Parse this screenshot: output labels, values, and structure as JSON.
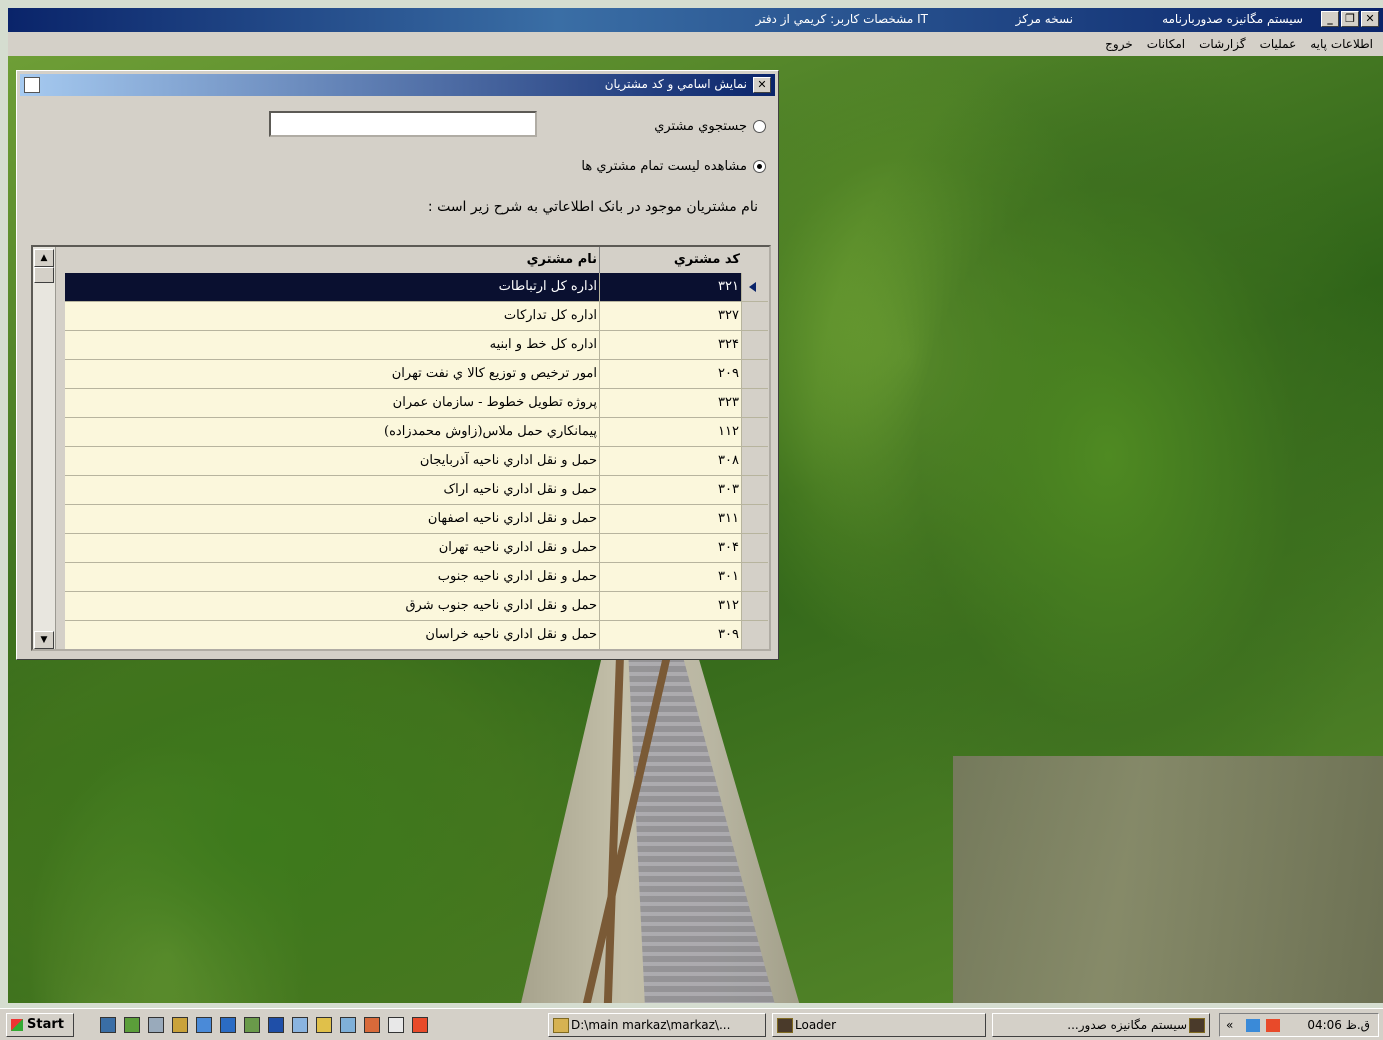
{
  "app": {
    "title_main": "سيستم مگانيزه صدوربارنامه",
    "title_version": "نسخه مرکز",
    "title_user": "مشخصات کاربر: کريمي از دفتر IT"
  },
  "menu": [
    "اطلاعات پايه",
    "عمليات",
    "گزارشات",
    "امکانات",
    "خروج"
  ],
  "dialog": {
    "title": "نمايش اسامي و کد مشتريان",
    "radio_search_label": "جستجوي مشتري",
    "radio_list_label": "مشاهده ليست تمام مشتري ها",
    "search_value": "",
    "description": "نام مشتريان  موجود در بانک اطلاعاتي به شرح زير است :",
    "columns": {
      "code": "کد مشتري",
      "name": "نام مشتري"
    },
    "rows": [
      {
        "code": "۳۲۱",
        "name": "اداره کل ارتباطات"
      },
      {
        "code": "۳۲۷",
        "name": "اداره کل تدارکات"
      },
      {
        "code": "۳۲۴",
        "name": "اداره کل خط و ابنيه"
      },
      {
        "code": "۲۰۹",
        "name": "امور ترخيص و توزيع کالا ي نفت تهران"
      },
      {
        "code": "۳۲۳",
        "name": "پروژه تطويل خطوط - سازمان عمران"
      },
      {
        "code": "۱۱۲",
        "name": "پيمانکاري حمل ملاس(زاوش محمدزاده)"
      },
      {
        "code": "۳۰۸",
        "name": "حمل و نقل اداري ناحيه آذربايجان"
      },
      {
        "code": "۳۰۳",
        "name": "حمل و نقل اداري ناحيه اراک"
      },
      {
        "code": "۳۱۱",
        "name": "حمل و نقل اداري ناحيه اصفهان"
      },
      {
        "code": "۳۰۴",
        "name": "حمل و نقل اداري ناحيه تهران"
      },
      {
        "code": "۳۰۱",
        "name": "حمل و نقل اداري ناحيه جنوب"
      },
      {
        "code": "۳۱۲",
        "name": "حمل و نقل اداري ناحيه جنوب شرق"
      },
      {
        "code": "۳۰۹",
        "name": "حمل و نقل اداري ناحيه خراسان"
      }
    ],
    "selected_row": 0
  },
  "taskbar": {
    "start": "Start",
    "tasks": [
      "D:\\main markaz\\markaz\\...",
      "Loader",
      "سيستم مگانيزه صدور..."
    ],
    "clock": "04:06 ق.ظ"
  },
  "colors": {
    "titlebar": "#0a246a",
    "row_bg": "#fbf7dc",
    "selected_row": "#0a1030"
  }
}
